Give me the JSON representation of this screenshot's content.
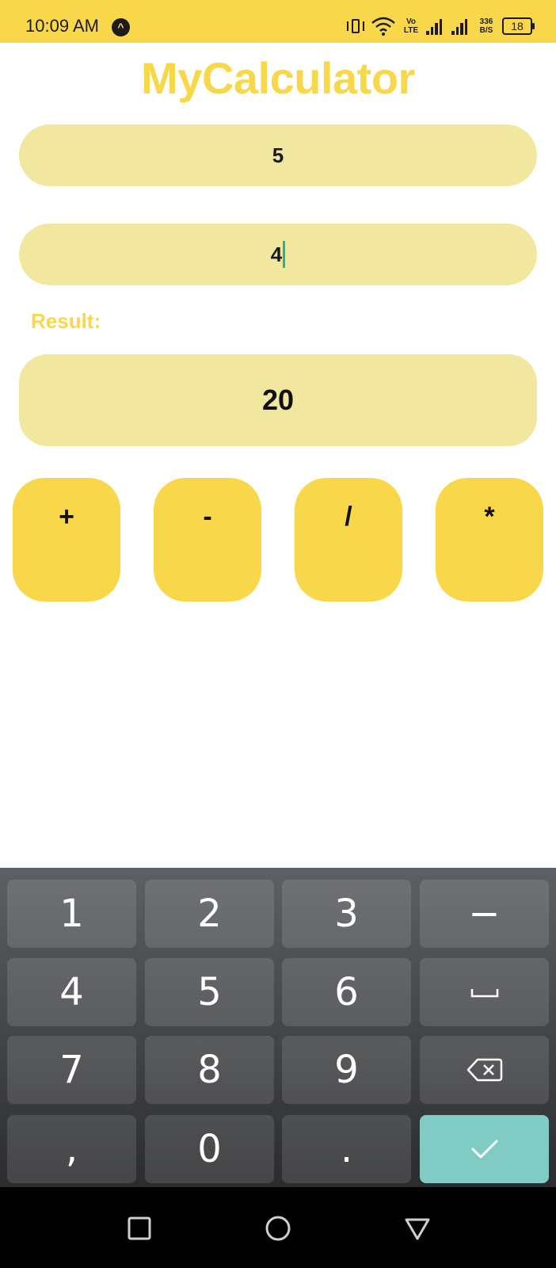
{
  "status_bar": {
    "time": "10:09 AM",
    "app_icon_glyph": "^",
    "volte": [
      "Vo",
      "LTE"
    ],
    "net_speed": [
      "336",
      "B/S"
    ],
    "battery": "18",
    "icons": [
      "vibrate-icon",
      "wifi-icon",
      "volte-icon",
      "signal-icon",
      "signal-icon",
      "battery-icon"
    ]
  },
  "app": {
    "title": "MyCalculator",
    "first_number": "5",
    "second_number": "4",
    "result_label": "Result:",
    "result_value": "20",
    "operators": [
      "+",
      "-",
      "/",
      "*"
    ]
  },
  "keyboard": {
    "rows": [
      [
        "1",
        "2",
        "3",
        "−"
      ],
      [
        "4",
        "5",
        "6",
        "space-icon"
      ],
      [
        "7",
        "8",
        "9",
        "backspace-icon"
      ],
      [
        ",",
        "0",
        ".",
        "checkmark-icon"
      ]
    ]
  },
  "nav_bar": {
    "buttons": [
      "recents-square-icon",
      "home-circle-icon",
      "back-triangle-icon"
    ]
  },
  "colors": {
    "primary_yellow": "#F8D84A",
    "field_yellow": "#F2E79E",
    "cursor_teal": "#1fb79a",
    "done_key": "#80CBC4"
  }
}
